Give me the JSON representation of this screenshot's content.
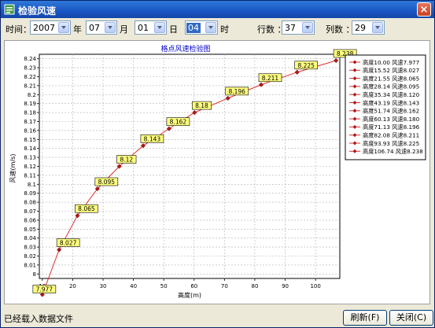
{
  "window": {
    "title": "检验风速"
  },
  "toolbar": {
    "time_label": "时间：",
    "year_value": "2007",
    "year_unit": "年",
    "month_value": "07",
    "month_unit": "月",
    "day_value": "01",
    "day_unit": "日",
    "hour_value": "04",
    "hour_unit": "时",
    "rows_label": "行数 ：",
    "rows_value": "37",
    "cols_label": "列数 ：",
    "cols_value": "29"
  },
  "status": "已经载入数据文件",
  "buttons": {
    "refresh": "刷新(F)",
    "close": "关闭(C)"
  },
  "colors": {
    "line": "#e03030",
    "marker": "#b01818",
    "label_bg": "#ffff80"
  },
  "chart_data": {
    "type": "line",
    "title": "格点风速检验图",
    "xlabel": "高度(m)",
    "ylabel": "风速(m/s)",
    "xlim": [
      9,
      108
    ],
    "ylim": [
      7.995,
      8.245
    ],
    "xticks": [
      10,
      20,
      30,
      40,
      50,
      60,
      70,
      80,
      90,
      100
    ],
    "yticks": [
      8,
      8.01,
      8.02,
      8.03,
      8.04,
      8.05,
      8.06,
      8.07,
      8.08,
      8.09,
      8.1,
      8.11,
      8.12,
      8.13,
      8.14,
      8.15,
      8.16,
      8.17,
      8.18,
      8.19,
      8.2,
      8.21,
      8.22,
      8.23,
      8.24
    ],
    "grid": true,
    "legend_position": "right",
    "x": [
      10.0,
      15.52,
      21.55,
      28.14,
      35.34,
      43.19,
      51.74,
      60.13,
      71.13,
      82.08,
      93.93,
      106.74
    ],
    "y": [
      7.977,
      8.027,
      8.065,
      8.095,
      8.12,
      8.143,
      8.162,
      8.18,
      8.196,
      8.211,
      8.225,
      8.238
    ],
    "point_labels": [
      "7.977",
      "8.027",
      "8.065",
      "8.095",
      "8.12",
      "8.143",
      "8.162",
      "8.18",
      "8.196",
      "8.211",
      "8.225",
      "8.238"
    ],
    "legend": [
      "高度10.00  风速7.977",
      "高度15.52  风速8.027",
      "高度21.55  风速8.065",
      "高度28.14  风速8.095",
      "高度35.34  风速8.120",
      "高度43.19  风速8.143",
      "高度51.74  风速8.162",
      "高度60.13  风速8.180",
      "高度71.13  风速8.196",
      "高度82.08  风速8.211",
      "高度93.93  风速8.225",
      "高度106.74 风速8.238"
    ]
  }
}
